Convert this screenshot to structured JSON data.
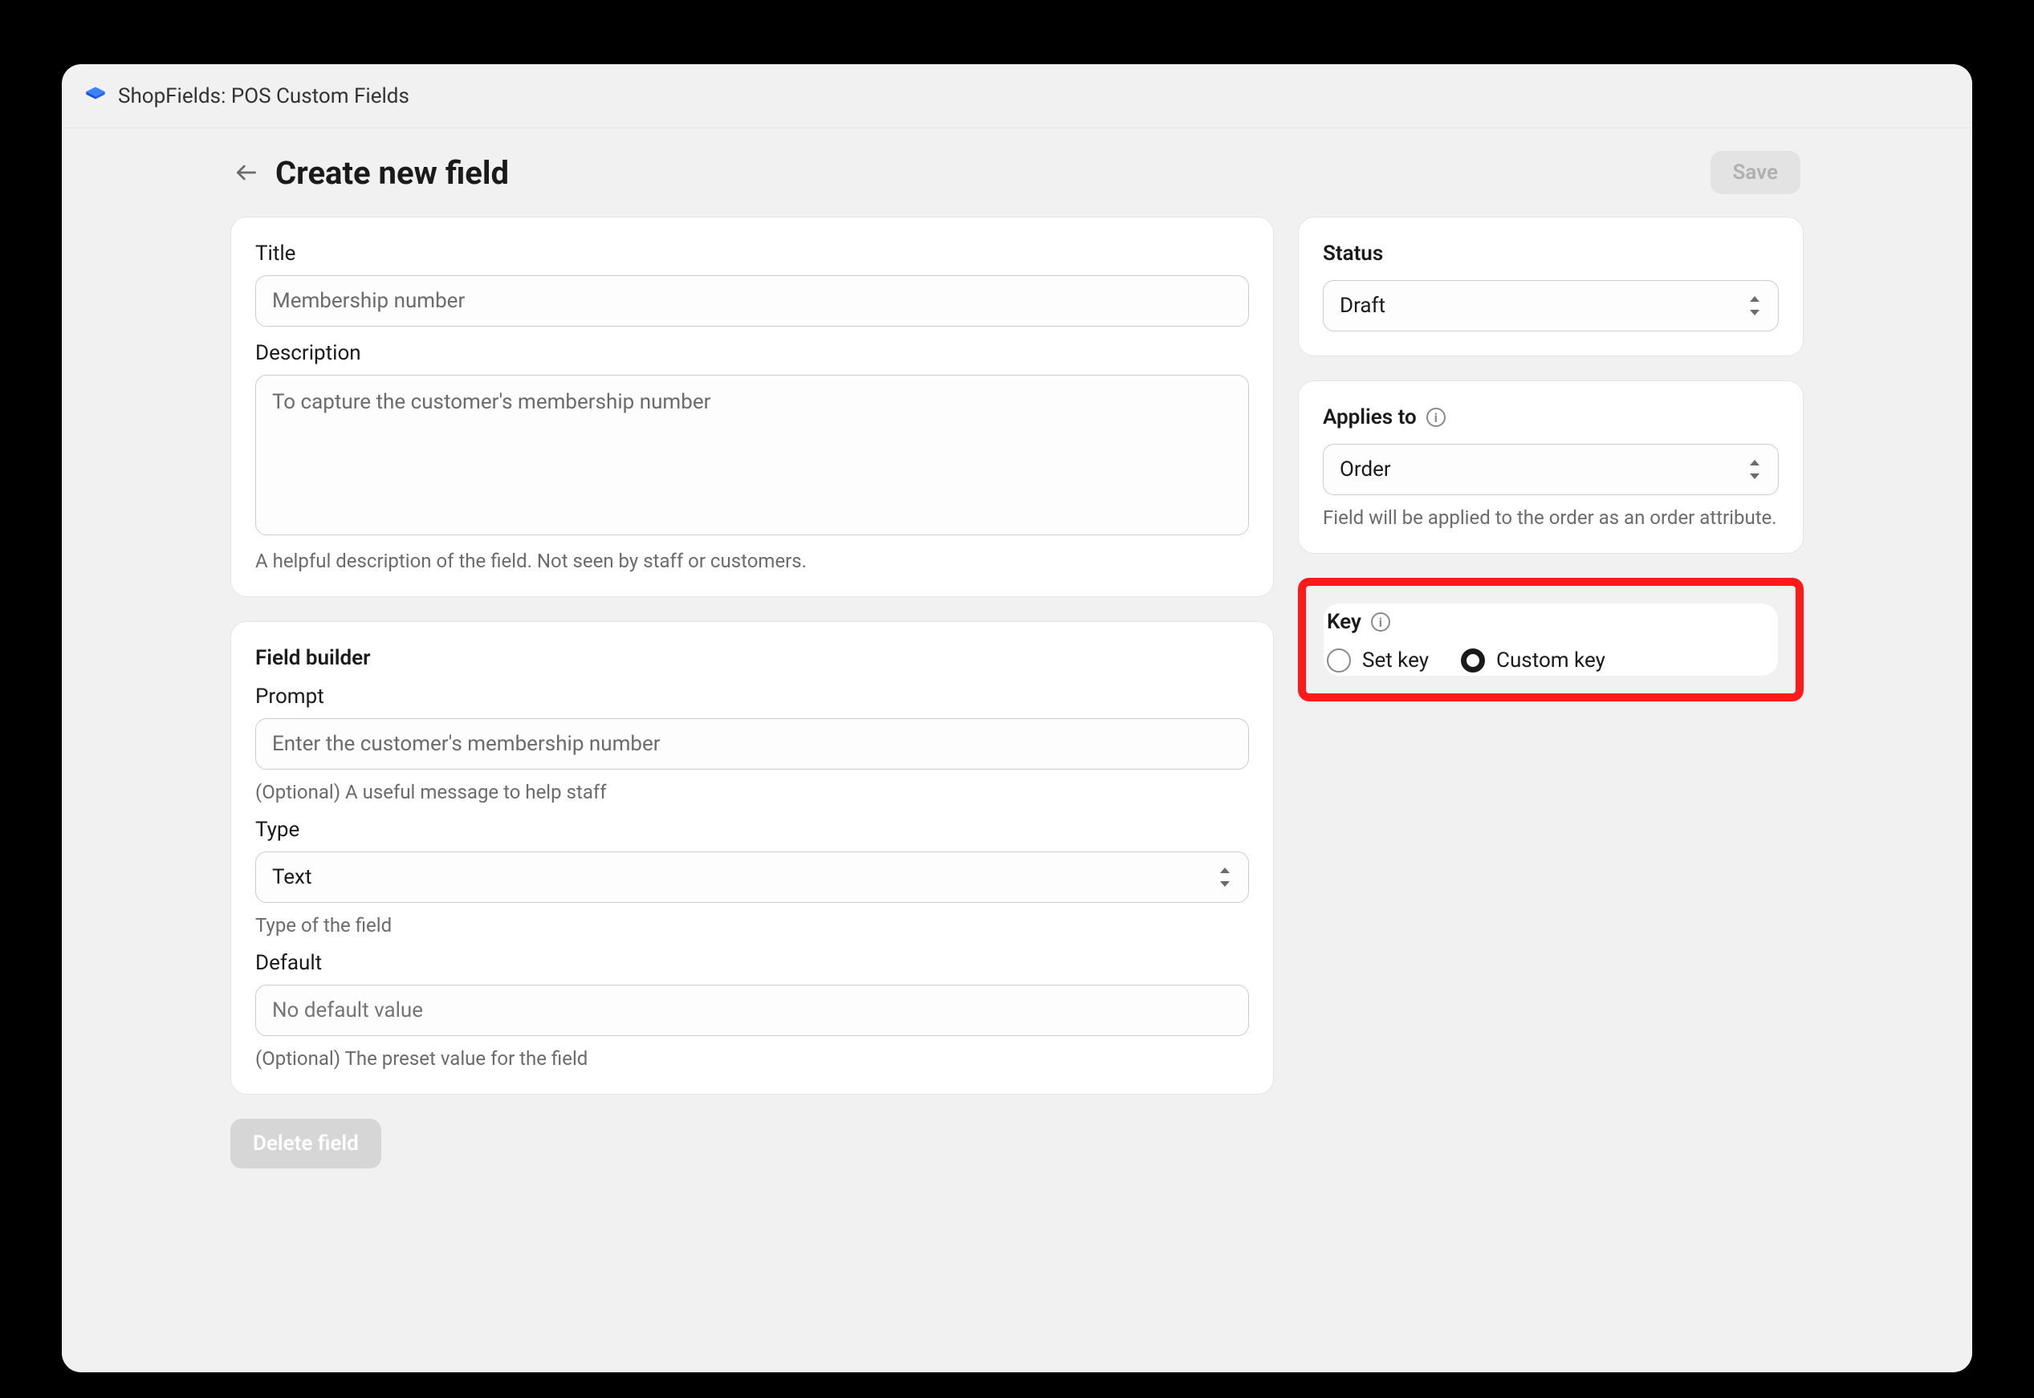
{
  "app": {
    "title": "ShopFields: POS Custom Fields"
  },
  "page": {
    "title": "Create new field",
    "save": "Save"
  },
  "main": {
    "title_label": "Title",
    "title_value": "Membership number",
    "description_label": "Description",
    "description_value": "To capture the customer's membership number",
    "description_help": "A helpful description of the field. Not seen by staff or customers.",
    "builder_title": "Field builder",
    "prompt_label": "Prompt",
    "prompt_value": "Enter the customer's membership number",
    "prompt_help": "(Optional) A useful message to help staff",
    "type_label": "Type",
    "type_value": "Text",
    "type_help": "Type of the field",
    "default_label": "Default",
    "default_placeholder": "No default value",
    "default_help": "(Optional) The preset value for the field"
  },
  "side": {
    "status_title": "Status",
    "status_value": "Draft",
    "applies_title": "Applies to",
    "applies_value": "Order",
    "applies_help": "Field will be applied to the order as an order attribute.",
    "key_title": "Key",
    "key_opt1": "Set key",
    "key_opt2": "Custom key"
  },
  "footer": {
    "delete": "Delete field"
  }
}
